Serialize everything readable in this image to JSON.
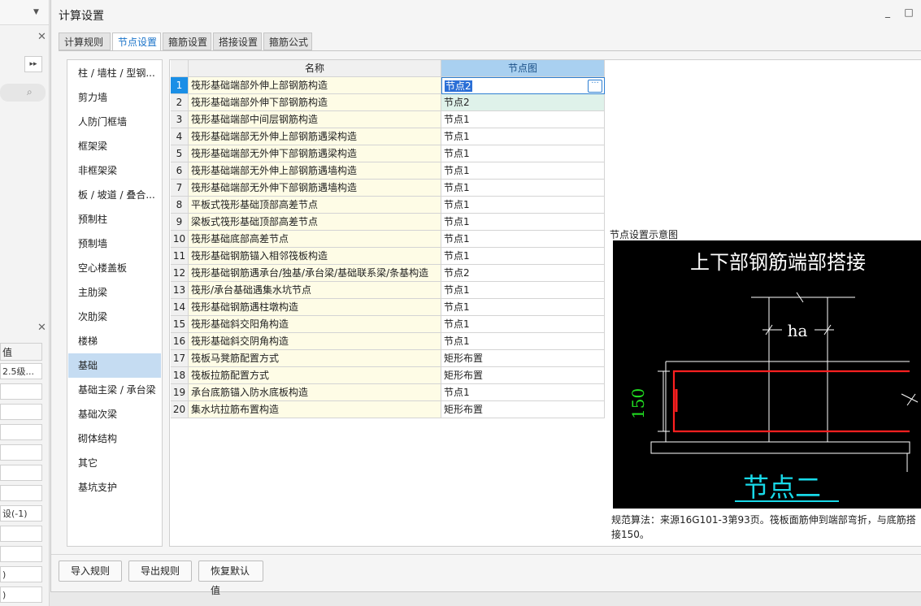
{
  "background": {
    "fields": [
      "2.5级...",
      "设(-1)",
      ")",
      ")"
    ],
    "header_label": "值"
  },
  "dialog": {
    "title": "计算设置",
    "minimize_glyph": "_",
    "maximize_glyph": "□"
  },
  "tabs": [
    {
      "label": "计算规则"
    },
    {
      "label": "节点设置"
    },
    {
      "label": "箍筋设置"
    },
    {
      "label": "搭接设置"
    },
    {
      "label": "箍筋公式"
    }
  ],
  "sidebar": {
    "items": [
      {
        "label": "柱 / 墙柱 / 型钢..."
      },
      {
        "label": "剪力墙"
      },
      {
        "label": "人防门框墙"
      },
      {
        "label": "框架梁"
      },
      {
        "label": "非框架梁"
      },
      {
        "label": "板 / 坡道 / 叠合..."
      },
      {
        "label": "预制柱"
      },
      {
        "label": "预制墙"
      },
      {
        "label": "空心楼盖板"
      },
      {
        "label": "主肋梁"
      },
      {
        "label": "次肋梁"
      },
      {
        "label": "楼梯"
      },
      {
        "label": "基础"
      },
      {
        "label": "基础主梁 / 承台梁"
      },
      {
        "label": "基础次梁"
      },
      {
        "label": "砌体结构"
      },
      {
        "label": "其它"
      },
      {
        "label": "基坑支护"
      }
    ],
    "active_index": 12
  },
  "table": {
    "headers": {
      "name": "名称",
      "node": "节点图"
    },
    "rows": [
      {
        "num": "1",
        "name": "筏形基础端部外伸上部钢筋构造",
        "value": "节点2"
      },
      {
        "num": "2",
        "name": "筏形基础端部外伸下部钢筋构造",
        "value": "节点2"
      },
      {
        "num": "3",
        "name": "筏形基础端部中间层钢筋构造",
        "value": "节点1"
      },
      {
        "num": "4",
        "name": "筏形基础端部无外伸上部钢筋遇梁构造",
        "value": "节点1"
      },
      {
        "num": "5",
        "name": "筏形基础端部无外伸下部钢筋遇梁构造",
        "value": "节点1"
      },
      {
        "num": "6",
        "name": "筏形基础端部无外伸上部钢筋遇墙构造",
        "value": "节点1"
      },
      {
        "num": "7",
        "name": "筏形基础端部无外伸下部钢筋遇墙构造",
        "value": "节点1"
      },
      {
        "num": "8",
        "name": "平板式筏形基础顶部高差节点",
        "value": "节点1"
      },
      {
        "num": "9",
        "name": "梁板式筏形基础顶部高差节点",
        "value": "节点1"
      },
      {
        "num": "10",
        "name": "筏形基础底部高差节点",
        "value": "节点1"
      },
      {
        "num": "11",
        "name": "筏形基础钢筋锚入相邻筏板构造",
        "value": "节点1"
      },
      {
        "num": "12",
        "name": "筏形基础钢筋遇承台/独基/承台梁/基础联系梁/条基构造",
        "value": "节点2"
      },
      {
        "num": "13",
        "name": "筏形/承台基础遇集水坑节点",
        "value": "节点1"
      },
      {
        "num": "14",
        "name": "筏形基础钢筋遇柱墩构造",
        "value": "节点1"
      },
      {
        "num": "15",
        "name": "筏形基础斜交阳角构造",
        "value": "节点1"
      },
      {
        "num": "16",
        "name": "筏形基础斜交阴角构造",
        "value": "节点1"
      },
      {
        "num": "17",
        "name": "筏板马凳筋配置方式",
        "value": "矩形布置"
      },
      {
        "num": "18",
        "name": "筏板拉筋配置方式",
        "value": "矩形布置"
      },
      {
        "num": "19",
        "name": "承台底筋锚入防水底板构造",
        "value": "节点1"
      },
      {
        "num": "20",
        "name": "集水坑拉筋布置构造",
        "value": "矩形布置"
      }
    ],
    "editing_row": 0,
    "editor_button": "···"
  },
  "preview": {
    "label": "节点设置示意图",
    "heading": "上下部钢筋端部搭接",
    "dim_ha": "ha",
    "dim_150": "150",
    "node_name": "节点二",
    "description": "规范算法：来源16G101-3第93页。筏板面筋伸到端部弯折，与底筋搭接150。"
  },
  "colors": {
    "accent": "#1a73c9",
    "rebar": "#ff2020",
    "dimension_green": "#22e022",
    "node_cyan": "#18d9e8",
    "editing_row_number": "#1a8fe6",
    "alt_value_bg": "#dff2ea"
  },
  "footer": {
    "import": "导入规则",
    "export": "导出规则",
    "restore": "恢复默认值"
  }
}
